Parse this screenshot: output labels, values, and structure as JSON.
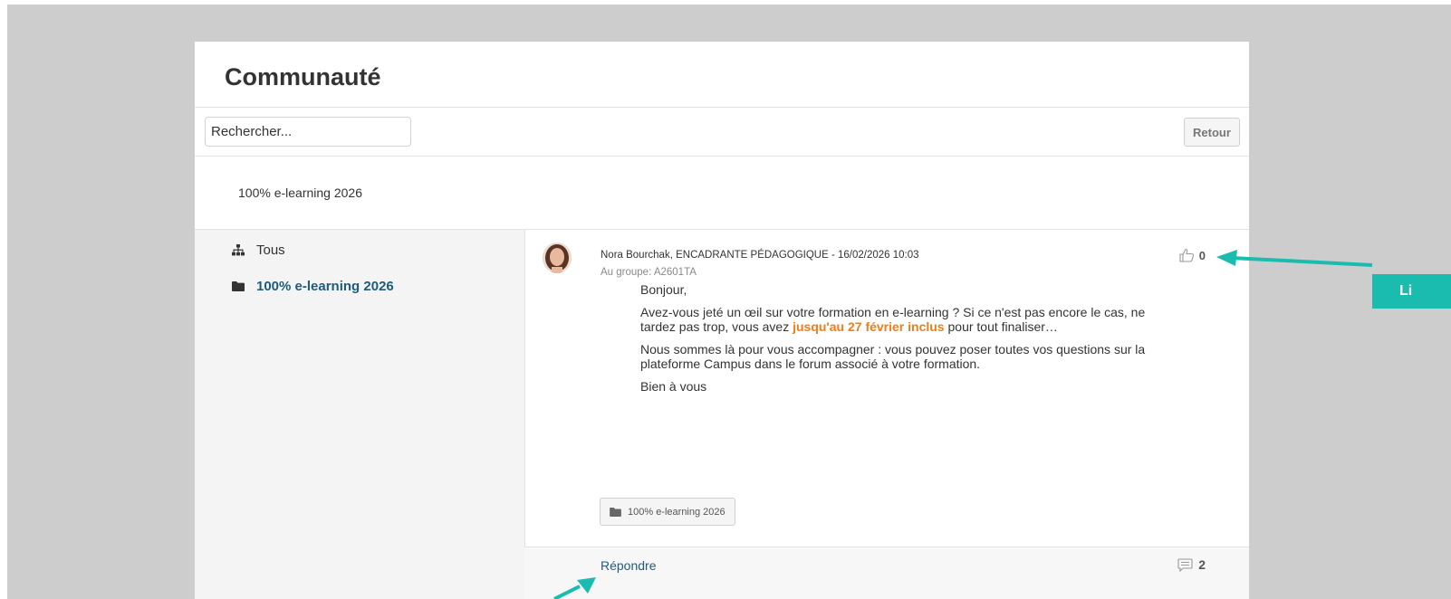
{
  "page": {
    "title": "Communauté"
  },
  "toolbar": {
    "search_placeholder": "Rechercher...",
    "back_label": "Retour"
  },
  "course": {
    "label": "100% e-learning 2026"
  },
  "sidebar": {
    "items": [
      {
        "label": "Tous",
        "icon": "sitemap-icon"
      },
      {
        "label": "100% e-learning 2026",
        "icon": "folder-icon",
        "active": true
      }
    ]
  },
  "post": {
    "meta": "Nora Bourchak, ENCADRANTE PÉDAGOGIQUE - 16/02/2026 10:03",
    "group": "Au groupe:  A2601TA",
    "likes": "0",
    "greeting": "Bonjour,",
    "para1_before": "Avez-vous jeté un œil sur votre formation en e-learning ? Si ce n'est pas encore le cas, ne tardez pas trop, vous avez ",
    "para1_highlight": "jusqu'au 27 février inclus",
    "para1_after": " pour tout finaliser…",
    "para2": "Nous sommes là pour vous accompagner : vous pouvez poser toutes vos questions sur la plateforme Campus dans le forum associé à votre formation.",
    "closing": "Bien à vous",
    "tag": "100% e-learning 2026",
    "reply_label": "Répondre",
    "comments_count": "2"
  },
  "annotation": {
    "callout_text": "Li"
  },
  "colors": {
    "backdrop": "#cdcdcd",
    "accent_link": "#1e5b7e",
    "highlight": "#f07d17",
    "annotation": "#1abcb0"
  }
}
